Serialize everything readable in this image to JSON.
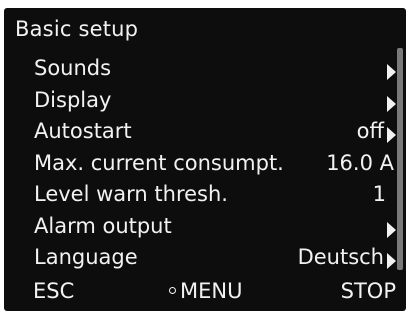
{
  "title": "Basic setup",
  "menu": {
    "sounds": {
      "label": "Sounds"
    },
    "display": {
      "label": "Display"
    },
    "autostart": {
      "label": "Autostart",
      "value": "off"
    },
    "max_current": {
      "label": "Max. current consumpt.",
      "value": "16.0 A"
    },
    "level_warn": {
      "label": "Level warn thresh.",
      "value": "1"
    },
    "alarm_output": {
      "label": "Alarm output"
    },
    "language": {
      "label": "Language",
      "value": "Deutsch"
    }
  },
  "footer": {
    "esc": "ESC",
    "menu": "MENU",
    "stop": "STOP"
  }
}
